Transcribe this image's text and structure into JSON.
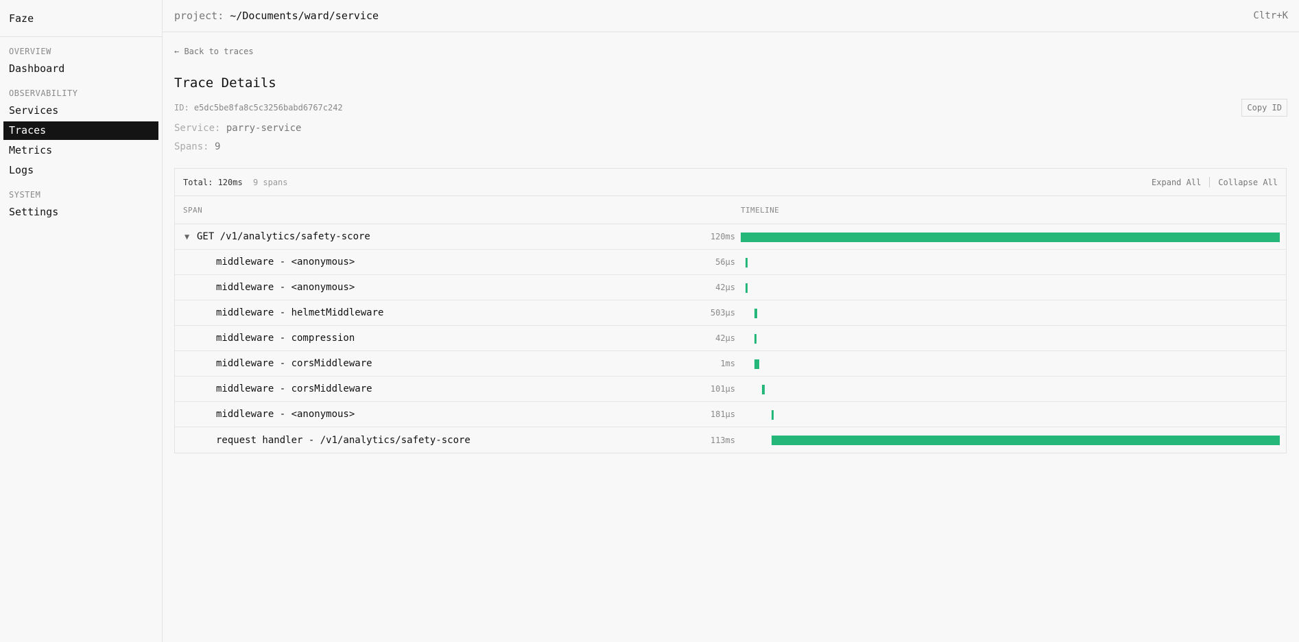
{
  "sidebar": {
    "brand": "Faze",
    "sections": [
      {
        "label": "OVERVIEW",
        "items": [
          {
            "label": "Dashboard",
            "active": false
          }
        ]
      },
      {
        "label": "OBSERVABILITY",
        "items": [
          {
            "label": "Services",
            "active": false
          },
          {
            "label": "Traces",
            "active": true
          },
          {
            "label": "Metrics",
            "active": false
          },
          {
            "label": "Logs",
            "active": false
          }
        ]
      },
      {
        "label": "SYSTEM",
        "items": [
          {
            "label": "Settings",
            "active": false
          }
        ]
      }
    ]
  },
  "topbar": {
    "project_label": "project:",
    "project_path": "~/Documents/ward/service",
    "shortcut": "Cltr+K"
  },
  "trace": {
    "back_label": "← Back to traces",
    "title": "Trace Details",
    "id_label": "ID:",
    "id_value": "e5dc5be8fa8c5c3256babd6767c242",
    "copy_label": "Copy ID",
    "service_label": "Service:",
    "service_value": "parry-service",
    "spans_label": "Spans:",
    "spans_value": "9",
    "total_label": "Total: 120ms",
    "span_count": "9 spans",
    "expand_label": "Expand All",
    "collapse_label": "Collapse All",
    "col_span": "SPAN",
    "col_timeline": "TIMELINE",
    "accent_color": "#25b77a",
    "rows": [
      {
        "name": "GET /v1/analytics/safety-score",
        "duration": "120ms",
        "root": true,
        "start_fraction": 0.0,
        "width_fraction": 1.0
      },
      {
        "name": "middleware - <anonymous>",
        "duration": "56µs",
        "root": false,
        "start_fraction": 0.009,
        "width_fraction": 0.004
      },
      {
        "name": "middleware - <anonymous>",
        "duration": "42µs",
        "root": false,
        "start_fraction": 0.009,
        "width_fraction": 0.004
      },
      {
        "name": "middleware - helmetMiddleware",
        "duration": "503µs",
        "root": false,
        "start_fraction": 0.025,
        "width_fraction": 0.005
      },
      {
        "name": "middleware - compression",
        "duration": "42µs",
        "root": false,
        "start_fraction": 0.025,
        "width_fraction": 0.004
      },
      {
        "name": "middleware - corsMiddleware",
        "duration": "1ms",
        "root": false,
        "start_fraction": 0.025,
        "width_fraction": 0.009
      },
      {
        "name": "middleware - corsMiddleware",
        "duration": "101µs",
        "root": false,
        "start_fraction": 0.04,
        "width_fraction": 0.004
      },
      {
        "name": "middleware - <anonymous>",
        "duration": "181µs",
        "root": false,
        "start_fraction": 0.057,
        "width_fraction": 0.004
      },
      {
        "name": "request handler - /v1/analytics/safety-score",
        "duration": "113ms",
        "root": false,
        "start_fraction": 0.057,
        "width_fraction": 0.943
      }
    ]
  }
}
